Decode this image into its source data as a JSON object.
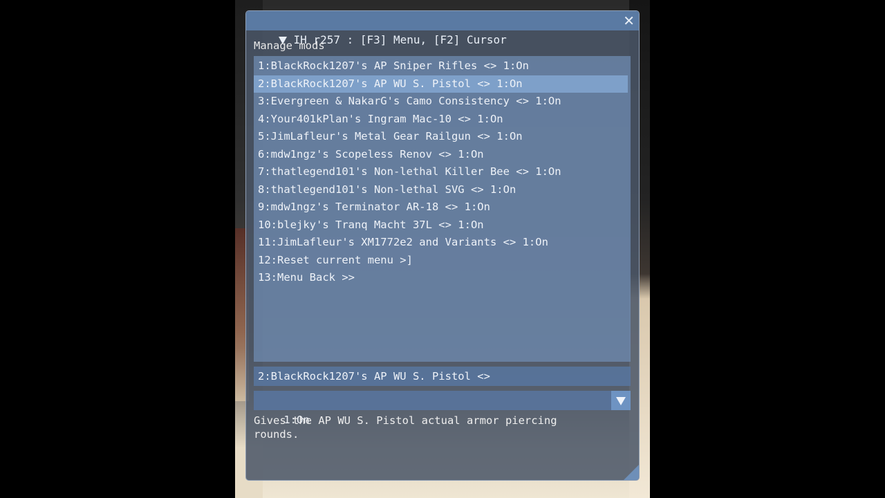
{
  "window": {
    "title": "IH r257 : [F3] Menu, [F2] Cursor",
    "close_glyph": "✕"
  },
  "menu": {
    "heading": "Manage mods",
    "items": [
      "1:BlackRock1207's AP Sniper Rifles <> 1:On",
      "2:BlackRock1207's AP WU S. Pistol <> 1:On",
      "3:Evergreen & NakarG's Camo Consistency <> 1:On",
      "4:Your401kPlan's Ingram Mac-10 <> 1:On",
      "5:JimLafleur's Metal Gear Railgun <> 1:On",
      "6:mdw1ngz's Scopeless Renov <> 1:On",
      "7:thatlegend101's Non-lethal Killer Bee <> 1:On",
      "8:thatlegend101's Non-lethal SVG <> 1:On",
      "9:mdw1ngz's Terminator AR-18 <> 1:On",
      "10:blejky's Tranq Macht 37L <> 1:On",
      "11:JimLafleur's XM1772e2 and Variants <> 1:On",
      "12:Reset current menu >]",
      "13:Menu Back >>"
    ],
    "selected_index": 1
  },
  "selected_setting": {
    "label": "2:BlackRock1207's AP WU S. Pistol <>",
    "value": "1:On",
    "description": "Gives the AP WU S. Pistol actual armor piercing\nrounds."
  }
}
